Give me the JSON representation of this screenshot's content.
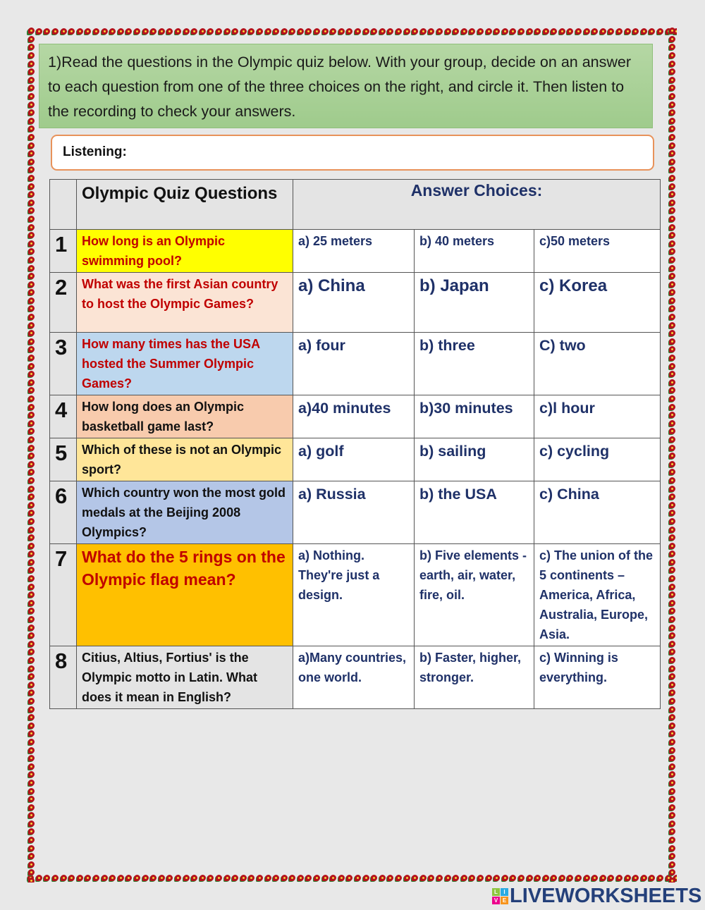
{
  "instructions": {
    "text": "1)Read the questions in the Olympic quiz below. With your group, decide on an answer to each question from one of the three choices on the right, and circle it. Then listen to the recording to check your answers."
  },
  "listening": {
    "label": "Listening:"
  },
  "table": {
    "header_questions": "Olympic Quiz Questions",
    "header_answers": "Answer Choices:",
    "rows": [
      {
        "number": "1",
        "question": "How long is an Olympic swimming pool?",
        "question_color": "#c00000",
        "background": "#ffff00",
        "choices": [
          "a) 25 meters",
          "b) 40 meters",
          "c)50 meters"
        ]
      },
      {
        "number": "2",
        "question": "What was the first Asian country to host the Olympic Games?",
        "question_color": "#c00000",
        "background": "#fbe4d5",
        "choices": [
          "a) China",
          "b) Japan",
          "c) Korea"
        ]
      },
      {
        "number": "3",
        "question": " How many times has the USA hosted the Summer Olympic Games?",
        "question_color": "#c00000",
        "background": "#bdd7ee",
        "choices": [
          "a) four",
          "b) three",
          "C) two"
        ]
      },
      {
        "number": "4",
        "question": "How long does an Olympic basketball game last?",
        "question_color": "#111111",
        "background": "#f8cbad",
        "choices": [
          "a)40 minutes",
          "b)30 minutes",
          "c)l hour"
        ]
      },
      {
        "number": "5",
        "question": " Which of these is not an Olympic sport?",
        "question_color": "#111111",
        "background": "#ffe699",
        "choices": [
          "a) golf",
          "b) sailing",
          "c) cycling"
        ]
      },
      {
        "number": "6",
        "question": "Which country won the most gold medals at the Beijing 2008 Olympics?",
        "question_color": "#111111",
        "background": "#b4c6e7",
        "choices": [
          "a) Russia",
          "b) the USA",
          "c) China"
        ]
      },
      {
        "number": "7",
        "question": " What do the 5 rings on the Olympic flag mean?",
        "question_color": "#c00000",
        "background": "#ffc000",
        "choices": [
          "a) Nothing. They're just a design.",
          "b) Five elements - earth, air, water, fire, oil.",
          "c) The union of the 5 continents – America, Africa, Australia, Europe, Asia."
        ]
      },
      {
        "number": "8",
        "question": "Citius, Altius, Fortius' is the Olympic motto in Latin. What does it mean in English?",
        "question_color": "#111111",
        "background": "#e4e4e4",
        "choices": [
          "a)Many countries, one world.",
          "b) Faster, higher, stronger.",
          "c) Winning is everything."
        ]
      }
    ]
  },
  "footer": {
    "brand": "LIVEWORKSHEETS",
    "badge_letters": [
      "L",
      "I",
      "V",
      "E"
    ],
    "badge_colors": [
      "#8dc63f",
      "#29abe2",
      "#ec008c",
      "#f7941d"
    ]
  }
}
